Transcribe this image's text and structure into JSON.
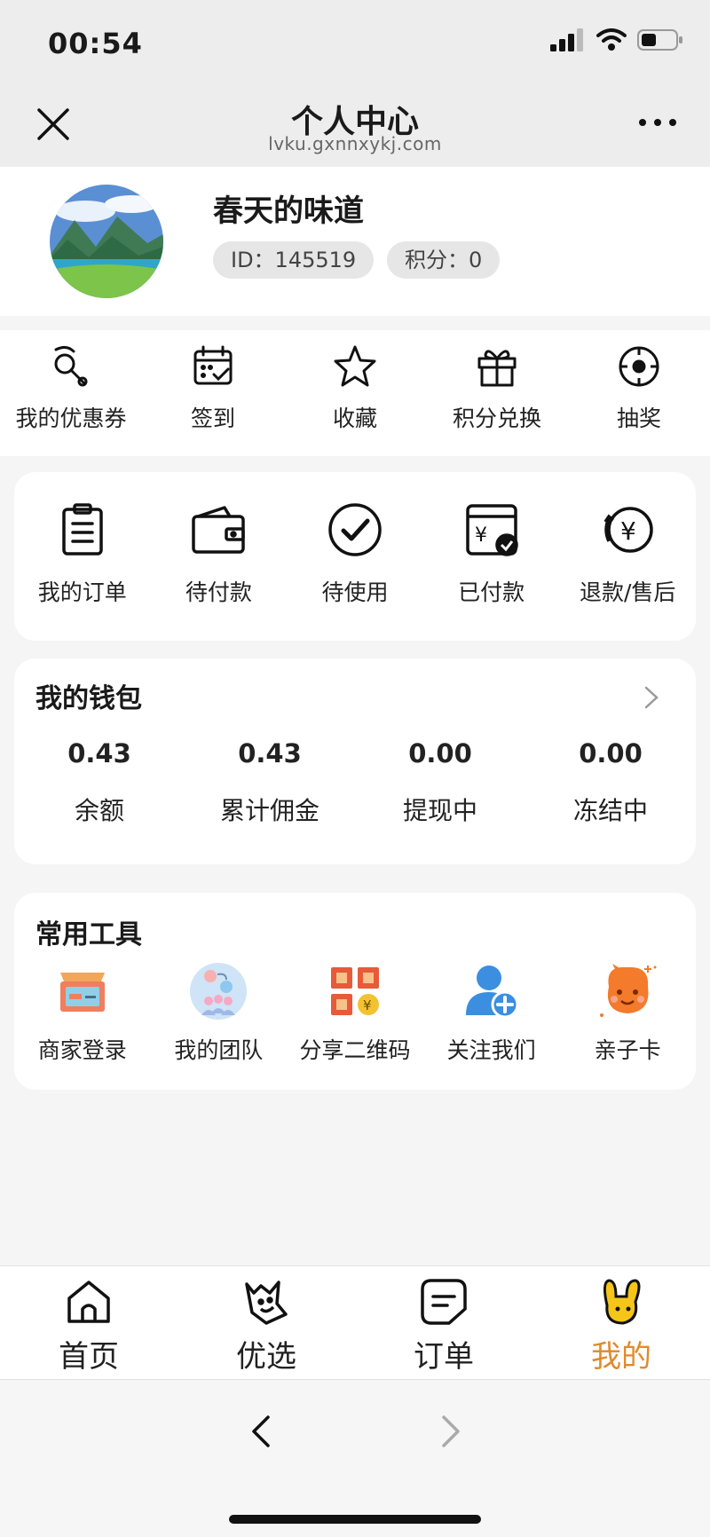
{
  "status_bar": {
    "time": "00:54"
  },
  "navbar": {
    "title": "个人中心",
    "subtitle": "lvku.gxnnxykj.com"
  },
  "profile": {
    "name": "春天的味道",
    "id_label": "ID：145519",
    "points_label": "积分：0"
  },
  "quick_actions": [
    {
      "label": "我的优惠券",
      "icon": "coupon-icon"
    },
    {
      "label": "签到",
      "icon": "calendar-check-icon"
    },
    {
      "label": "收藏",
      "icon": "star-icon"
    },
    {
      "label": "积分兑换",
      "icon": "gift-icon"
    },
    {
      "label": "抽奖",
      "icon": "lottery-wheel-icon"
    }
  ],
  "orders": [
    {
      "label": "我的订单",
      "icon": "clipboard-icon"
    },
    {
      "label": "待付款",
      "icon": "wallet-icon"
    },
    {
      "label": "待使用",
      "icon": "check-circle-icon"
    },
    {
      "label": "已付款",
      "icon": "paid-card-icon"
    },
    {
      "label": "退款/售后",
      "icon": "refund-icon"
    }
  ],
  "wallet": {
    "title": "我的钱包",
    "items": [
      {
        "value": "0.43",
        "label": "余额"
      },
      {
        "value": "0.43",
        "label": "累计佣金"
      },
      {
        "value": "0.00",
        "label": "提现中"
      },
      {
        "value": "0.00",
        "label": "冻结中"
      }
    ]
  },
  "tools": {
    "title": "常用工具",
    "items": [
      {
        "label": "商家登录",
        "icon": "merchant-box-icon"
      },
      {
        "label": "我的团队",
        "icon": "team-icon"
      },
      {
        "label": "分享二维码",
        "icon": "qr-share-icon"
      },
      {
        "label": "关注我们",
        "icon": "follow-user-icon"
      },
      {
        "label": "亲子卡",
        "icon": "kid-face-icon"
      }
    ]
  },
  "tabbar": [
    {
      "label": "首页",
      "icon": "home-icon"
    },
    {
      "label": "优选",
      "icon": "smile-bag-icon"
    },
    {
      "label": "订单",
      "icon": "order-list-icon"
    },
    {
      "label": "我的",
      "icon": "bunny-icon",
      "active": true
    }
  ],
  "colors": {
    "accent": "#e08a2c",
    "bg": "#f5f5f5",
    "header": "#ededed"
  }
}
